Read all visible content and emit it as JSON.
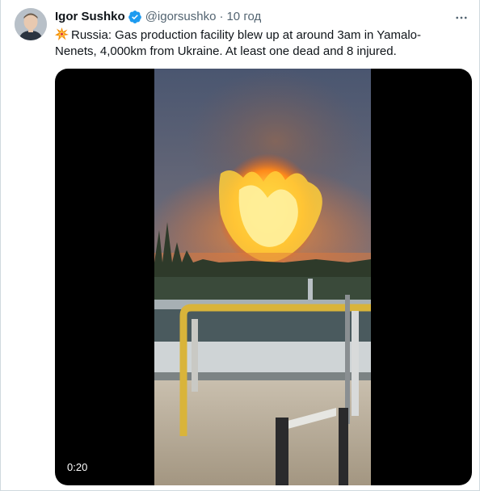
{
  "tweet": {
    "author_name": "Igor Sushko",
    "author_handle": "@igorsushko",
    "separator": "·",
    "time": "10 год",
    "text": "Russia: Gas production facility blew up at around 3am in Yamalo-Nenets, 4,000km from Ukraine. At least one dead and 8 injured.",
    "emoji": "collision-emoji",
    "verified": true,
    "more_icon": "more-dots-icon"
  },
  "video": {
    "duration": "0:20",
    "description_icon": "video-player"
  },
  "colors": {
    "accent": "#1d9bf0",
    "text": "#0f1419",
    "secondary": "#536471",
    "border": "#cfd9de"
  }
}
